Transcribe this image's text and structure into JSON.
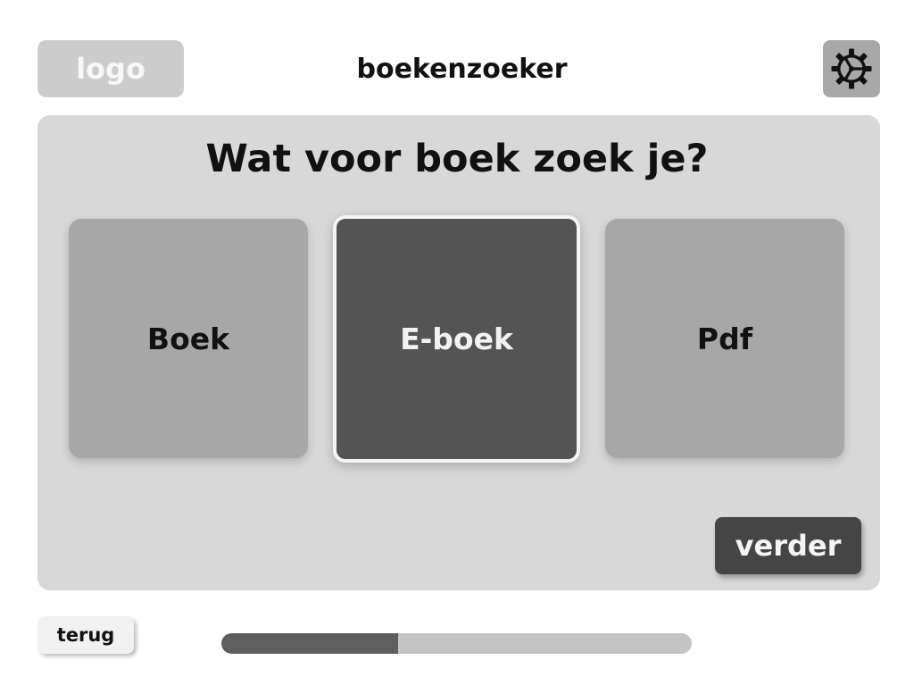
{
  "header": {
    "logo_text": "logo",
    "title": "boekenzoeker",
    "settings_icon": "gear-icon"
  },
  "main": {
    "question": "Wat voor boek zoek je?",
    "options": [
      {
        "label": "Boek",
        "selected": false
      },
      {
        "label": "E-boek",
        "selected": true
      },
      {
        "label": "Pdf",
        "selected": false
      }
    ],
    "next_label": "verder"
  },
  "footer": {
    "back_label": "terug",
    "progress": 0.375
  },
  "colors": {
    "panel": "#d8d8d8",
    "option": "#a7a7a7",
    "option_selected": "#545454",
    "primary_button": "#454545",
    "progress_fill": "#5e5e5e",
    "progress_track": "#c4c4c4"
  }
}
